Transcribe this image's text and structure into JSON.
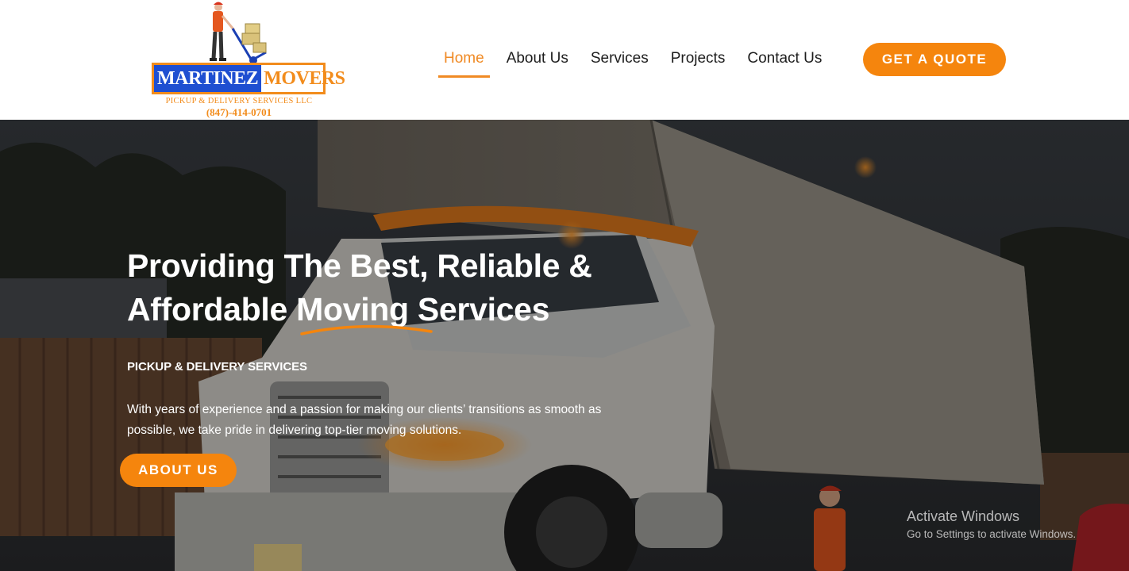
{
  "brand": {
    "name_part1": "MARTINEZ",
    "name_part2": "MOVERS",
    "tagline": "PICKUP & DELIVERY SERVICES LLC",
    "phone": "(847)-414-0701",
    "logo_icon": "mover-with-hand-truck-icon",
    "orange": "#f5850d",
    "blue": "#1f4fd1"
  },
  "nav": {
    "items": [
      {
        "label": "Home",
        "active": true
      },
      {
        "label": "About Us",
        "active": false
      },
      {
        "label": "Services",
        "active": false
      },
      {
        "label": "Projects",
        "active": false
      },
      {
        "label": "Contact Us",
        "active": false
      }
    ],
    "cta_label": "GET A QUOTE"
  },
  "hero": {
    "title_line1": "Providing The Best, Reliable &",
    "title_line2": "Affordable Moving Services",
    "kicker": "PICKUP & DELIVERY SERVICES",
    "description": "With years of experience and a passion for making our clients’ transitions as smooth as possible, we take pride in delivering top-tier moving solutions.",
    "button_label": "ABOUT US",
    "background": "moving-truck-at-dusk-photo"
  },
  "os_watermark": {
    "title": "Activate Windows",
    "subtitle": "Go to Settings to activate Windows."
  }
}
